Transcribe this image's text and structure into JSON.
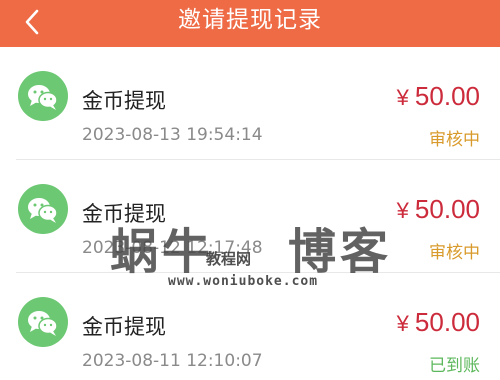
{
  "header": {
    "title": "邀请提现记录",
    "back_icon": "chevron-left-icon",
    "background_color": "#ee6b46"
  },
  "records": [
    {
      "title": "金币提现",
      "time": "2023-08-13 19:54:14",
      "currency": "¥",
      "amount": "50.00",
      "status": "审核中",
      "status_color": "#d89a2a",
      "icon": "wechat-icon"
    },
    {
      "title": "金币提现",
      "time": "2023-08-12 12:17:48",
      "currency": "¥",
      "amount": "50.00",
      "status": "审核中",
      "status_color": "#d89a2a",
      "icon": "wechat-icon"
    },
    {
      "title": "金币提现",
      "time": "2023-08-11 12:10:07",
      "currency": "¥",
      "amount": "50.00",
      "status": "已到账",
      "status_color": "#5cb85c",
      "icon": "wechat-icon"
    }
  ],
  "watermark": {
    "left": "蜗牛",
    "middle": "教程网",
    "right": "博客",
    "url": "www.woniuboke.com"
  }
}
